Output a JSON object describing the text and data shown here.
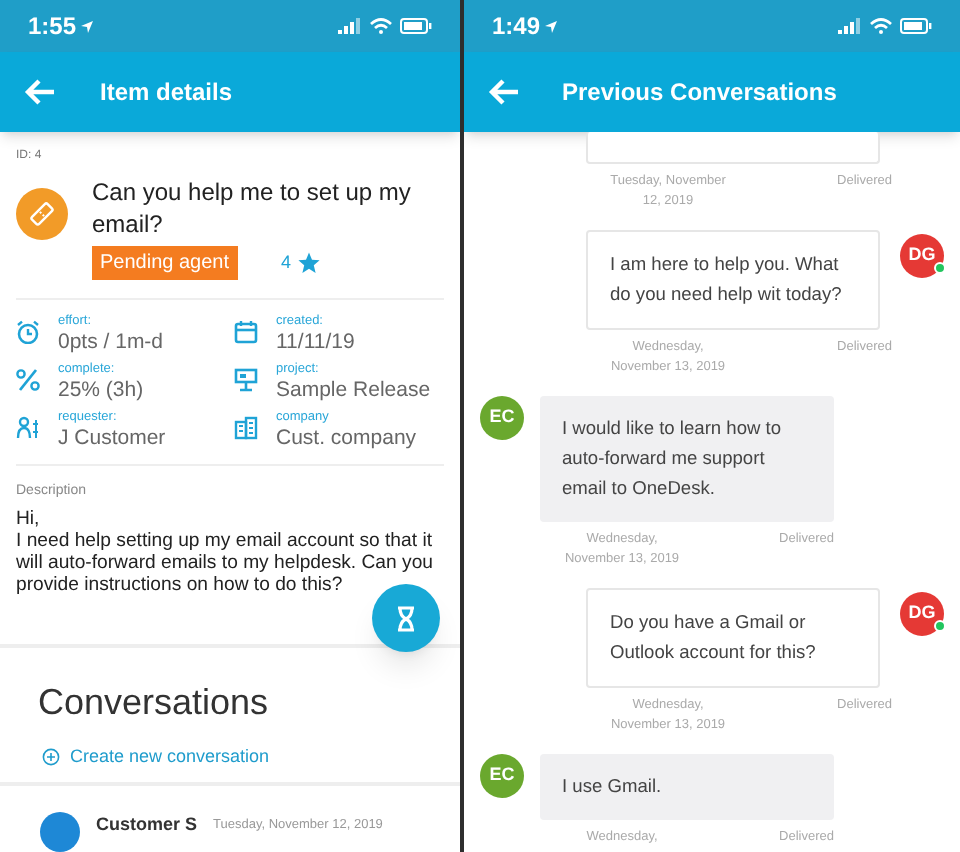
{
  "left": {
    "status_bar": {
      "time": "1:55"
    },
    "header": {
      "title": "Item details"
    },
    "item": {
      "id": "ID: 4",
      "title": "Can you help me to set up my email?",
      "badge": "Pending agent",
      "rating": "4"
    },
    "fields": [
      {
        "kind": "effort",
        "label": "effort:",
        "value": "0pts / 1m-d"
      },
      {
        "kind": "created",
        "label": "created:",
        "value": "11/11/19"
      },
      {
        "kind": "complete",
        "label": "complete:",
        "value": "25%  (3h)"
      },
      {
        "kind": "project",
        "label": "project:",
        "value": "Sample Release"
      },
      {
        "kind": "requester",
        "label": "requester:",
        "value": "J Customer"
      },
      {
        "kind": "company",
        "label": "company",
        "value": "Cust. company"
      }
    ],
    "description": {
      "label": "Description",
      "lines": [
        "Hi,",
        "I need help setting up my email account so that it will auto-forward emails to my helpdesk. Can you provide instructions on how to do this?"
      ]
    },
    "conversations": {
      "title": "Conversations",
      "create_link": "Create new conversation",
      "items": [
        {
          "author": "Customer S",
          "date": "Tuesday, November 12, 2019"
        }
      ]
    }
  },
  "right": {
    "status_bar": {
      "time": "1:49"
    },
    "header": {
      "title": "Previous Conversations"
    },
    "messages": [
      {
        "kind": "agent",
        "partial": true,
        "date": "Tuesday, November 12, 2019",
        "status": "Delivered"
      },
      {
        "kind": "agent",
        "text": "I am here to help you. What do you need help wit today?",
        "avatar": "DG",
        "color": "#e53935",
        "online": true,
        "date": "Wednesday, November 13, 2019",
        "status": "Delivered"
      },
      {
        "kind": "customer",
        "text": "I would like to learn how to auto-forward me support email to OneDesk.",
        "avatar": "EC",
        "color": "#6aa82e",
        "online": false,
        "date": "Wednesday, November 13, 2019",
        "status": "Delivered"
      },
      {
        "kind": "agent",
        "text": "Do you have a Gmail or Outlook account for this?",
        "avatar": "DG",
        "color": "#e53935",
        "online": true,
        "date": "Wednesday, November 13, 2019",
        "status": "Delivered"
      },
      {
        "kind": "customer",
        "text": "I use Gmail.",
        "avatar": "EC",
        "color": "#6aa82e",
        "online": false,
        "date": "Wednesday,",
        "status": "Delivered"
      }
    ]
  }
}
